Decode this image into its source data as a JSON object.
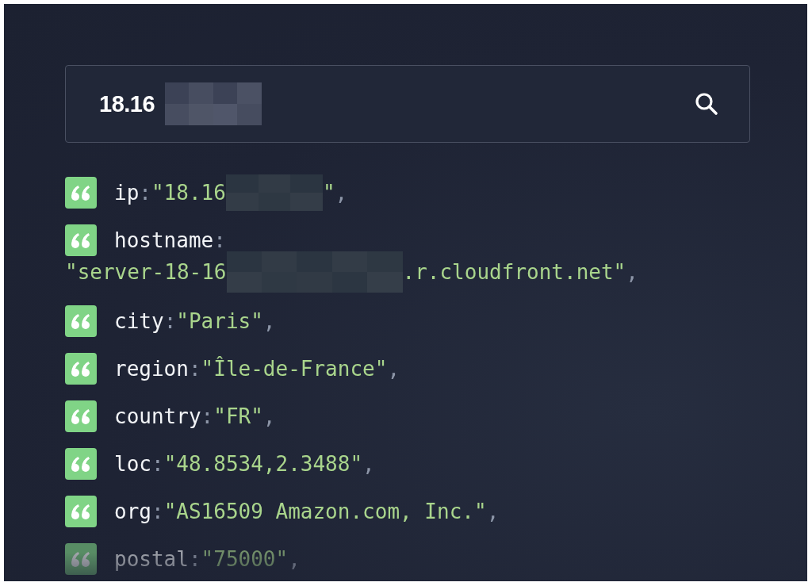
{
  "search": {
    "value": "18.16",
    "redacted": true
  },
  "rows": [
    {
      "kind": "inline",
      "key": "ip",
      "colon": ":",
      "value": "\"18.16",
      "redacted": true,
      "value_end": "\"",
      "comma": ",",
      "faded": false
    },
    {
      "kind": "wrapped",
      "key": "hostname",
      "colon": ":",
      "value": "\"server-18-16",
      "redacted": true,
      "value_end": ".r.cloudfront.net\"",
      "comma": ",",
      "faded": false
    },
    {
      "kind": "inline",
      "key": "city",
      "colon": ":",
      "value": "\"Paris\"",
      "redacted": false,
      "comma": ",",
      "faded": false
    },
    {
      "kind": "inline",
      "key": "region",
      "colon": ":",
      "value": "\"Île-de-France\"",
      "redacted": false,
      "comma": ",",
      "faded": false
    },
    {
      "kind": "inline",
      "key": "country",
      "colon": ":",
      "value": "\"FR\"",
      "redacted": false,
      "comma": ",",
      "faded": false
    },
    {
      "kind": "inline",
      "key": "loc",
      "colon": ":",
      "value": "\"48.8534,2.3488\"",
      "redacted": false,
      "comma": ",",
      "faded": false
    },
    {
      "kind": "inline",
      "key": "org",
      "colon": ":",
      "value": "\"AS16509 Amazon.com, Inc.\"",
      "redacted": false,
      "comma": ",",
      "faded": false
    },
    {
      "kind": "inline",
      "key": "postal",
      "colon": ":",
      "value": "\"75000\"",
      "redacted": false,
      "comma": ",",
      "faded": true
    }
  ]
}
